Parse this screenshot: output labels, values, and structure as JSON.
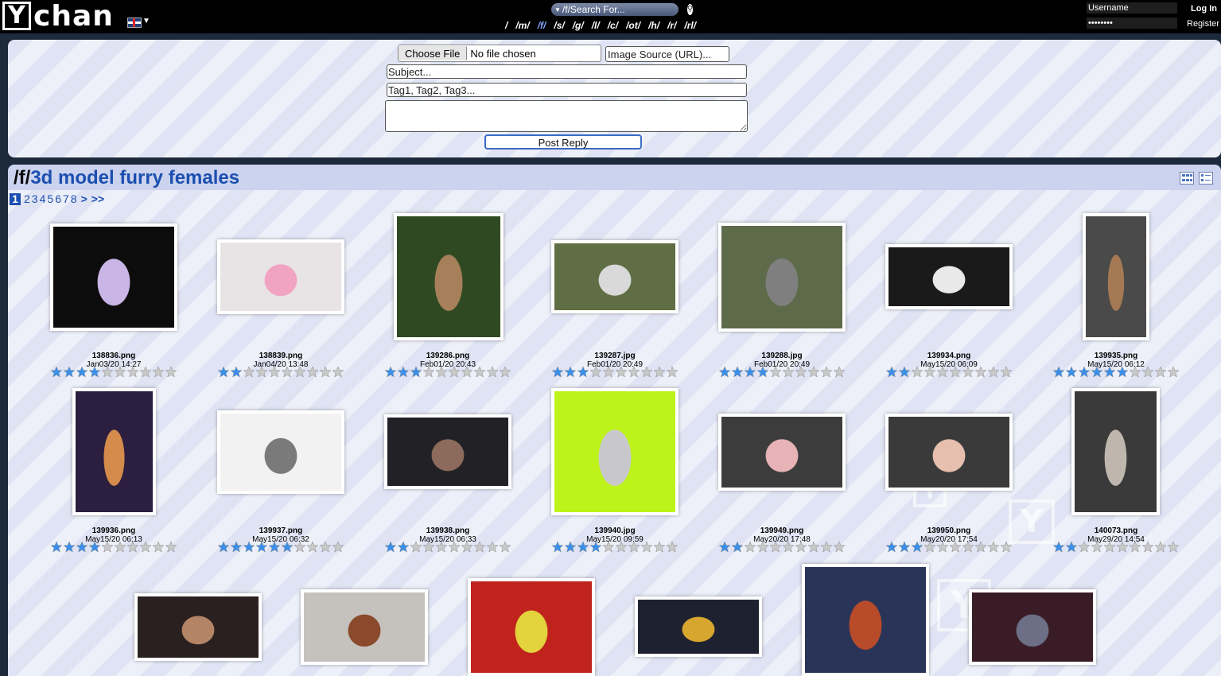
{
  "topbar": {
    "logo_letter": "Y",
    "logo_word": "chan",
    "language_flag": "uk-flag-icon",
    "search_placeholder": "/f/Search For...",
    "boards": [
      "/",
      "/m/",
      "/f/",
      "/s/",
      "/g/",
      "/l/",
      "/c/",
      "/ot/",
      "/h/",
      "/r/",
      "/rl/"
    ],
    "active_board": "/f/",
    "username_placeholder": "Username",
    "password_value": "••••••••",
    "login_label": "Log In",
    "register_label": "Register"
  },
  "form": {
    "choose_file_label": "Choose File",
    "file_status": "No file chosen",
    "image_source_placeholder": "Image Source (URL)...",
    "subject_placeholder": "Subject...",
    "tags_placeholder": "Tag1, Tag2, Tag3...",
    "message_value": "",
    "post_reply_label": "Post Reply"
  },
  "board": {
    "slug": "/f/",
    "title": "3d model furry females",
    "pages": [
      "1",
      "2",
      "3",
      "4",
      "5",
      "6",
      "7",
      "8"
    ],
    "current_page": "1",
    "next_label": ">",
    "last_label": ">>"
  },
  "colors": {
    "accent": "#1b4fb0",
    "star_filled": "#3b8fe8",
    "star_empty": "#c9c9c9"
  },
  "thumbnails": [
    {
      "filename": "138836.png",
      "date": "Jan03/20 14:27",
      "rating": 4,
      "bg": "#0c0c0c",
      "fg": "#c9b6e6"
    },
    {
      "filename": "138839.png",
      "date": "Jan04/20 13:48",
      "rating": 2,
      "bg": "#e8e4e6",
      "fg": "#f0a4bf"
    },
    {
      "filename": "139286.png",
      "date": "Feb01/20 20:43",
      "rating": 3,
      "bg": "#2f4a23",
      "fg": "#a6805a"
    },
    {
      "filename": "139287.jpg",
      "date": "Feb01/20 20:49",
      "rating": 3,
      "bg": "#5f6e44",
      "fg": "#d9d9d9"
    },
    {
      "filename": "139288.jpg",
      "date": "Feb01/20 20:49",
      "rating": 4,
      "bg": "#5d6b4a",
      "fg": "#7f7f7f"
    },
    {
      "filename": "139934.png",
      "date": "May15/20 06:09",
      "rating": 2,
      "bg": "#1a1a1a",
      "fg": "#e9e9e9"
    },
    {
      "filename": "139935.png",
      "date": "May15/20 06:12",
      "rating": 6,
      "bg": "#4a4a4a",
      "fg": "#a57954"
    },
    {
      "filename": "139936.png",
      "date": "May15/20 06:13",
      "rating": 4,
      "bg": "#2b1e3e",
      "fg": "#d48b4b"
    },
    {
      "filename": "139937.png",
      "date": "May15/20 06:32",
      "rating": 6,
      "bg": "#f2f2f2",
      "fg": "#7a7a7a"
    },
    {
      "filename": "139938.png",
      "date": "May15/20 06:33",
      "rating": 2,
      "bg": "#222226",
      "fg": "#8c6b5c"
    },
    {
      "filename": "139940.jpg",
      "date": "May15/20 09:59",
      "rating": 4,
      "bg": "#bdf31a",
      "fg": "#c8c8cc"
    },
    {
      "filename": "139949.png",
      "date": "May20/20 17:48",
      "rating": 2,
      "bg": "#3c3c3c",
      "fg": "#e7b3b6"
    },
    {
      "filename": "139950.png",
      "date": "May20/20 17:54",
      "rating": 3,
      "bg": "#3a3a3a",
      "fg": "#e6bfae"
    },
    {
      "filename": "140073.png",
      "date": "May29/20 14:54",
      "rating": 2,
      "bg": "#3a3a3a",
      "fg": "#bfb7ad"
    },
    {
      "filename": "",
      "date": "",
      "rating": 0,
      "bg": "#2a2020",
      "fg": "#b48467"
    },
    {
      "filename": "",
      "date": "",
      "rating": 0,
      "bg": "#c5c2bd",
      "fg": "#8a4a2b"
    },
    {
      "filename": "",
      "date": "",
      "rating": 0,
      "bg": "#c0231c",
      "fg": "#e3d33d"
    },
    {
      "filename": "",
      "date": "",
      "rating": 0,
      "bg": "#1e2230",
      "fg": "#d7a62e"
    },
    {
      "filename": "",
      "date": "",
      "rating": 0,
      "bg": "#2a3458",
      "fg": "#b74b2a"
    },
    {
      "filename": "",
      "date": "",
      "rating": 0,
      "bg": "#3a1c26",
      "fg": "#6c6f86"
    }
  ]
}
